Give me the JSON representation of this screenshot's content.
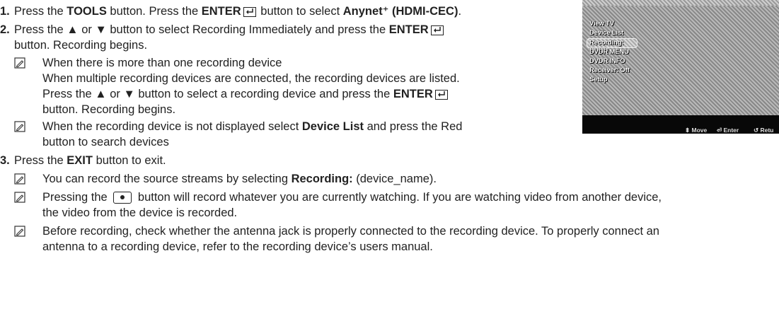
{
  "steps": [
    {
      "number": "1.",
      "pre1": "Press the ",
      "b1": "TOOLS",
      "mid1": " button. Press the ",
      "b2": "ENTER",
      "mid2": " button to select ",
      "b3": "Anynet⁺ (HDMI-CEC)",
      "end": "."
    },
    {
      "number": "2.",
      "line1_pre": "Press the ▲ or ▼ button to select Recording Immediately and press the ",
      "line1_b": "ENTER",
      "line2": "button. Recording begins."
    },
    {
      "number": "3.",
      "pre": "Press the ",
      "b": "EXIT",
      "post": " button to exit."
    }
  ],
  "notes": {
    "n1_title": "When there is more than one recording device",
    "n1_l1": "When multiple recording devices are connected, the recording devices are listed.",
    "n1_l2_pre": "Press the ▲ or ▼ button to select a recording device and press the ",
    "n1_l2_b": "ENTER",
    "n1_l3": "button. Recording begins.",
    "n2_pre": "When the recording device is not displayed select ",
    "n2_b": "Device List",
    "n2_post": " and press the Red",
    "n2_l2": "button to search devices",
    "n3_pre": "You can record the source streams by selecting ",
    "n3_b": "Recording:",
    "n3_post": " (device_name).",
    "n4_pre": "Pressing the ",
    "n4_post": " button will record whatever you are currently watching. If you are watching video from another device,",
    "n4_l2": "the video from the device is recorded.",
    "n5_l1": "Before recording, check whether the antenna jack is properly connected to the recording device. To properly connect an",
    "n5_l2": "antenna to a recording device, refer to the recording device’s users manual."
  },
  "tv_menu": {
    "items": [
      "View TV",
      "Device List",
      "Recording: DVDR",
      "DVDR MENU",
      "DVDR INFO",
      "Receiver: Off",
      "Setup"
    ],
    "selected_index": 2,
    "footer_move": "Move",
    "footer_enter": "Enter",
    "footer_return": "Retu"
  }
}
